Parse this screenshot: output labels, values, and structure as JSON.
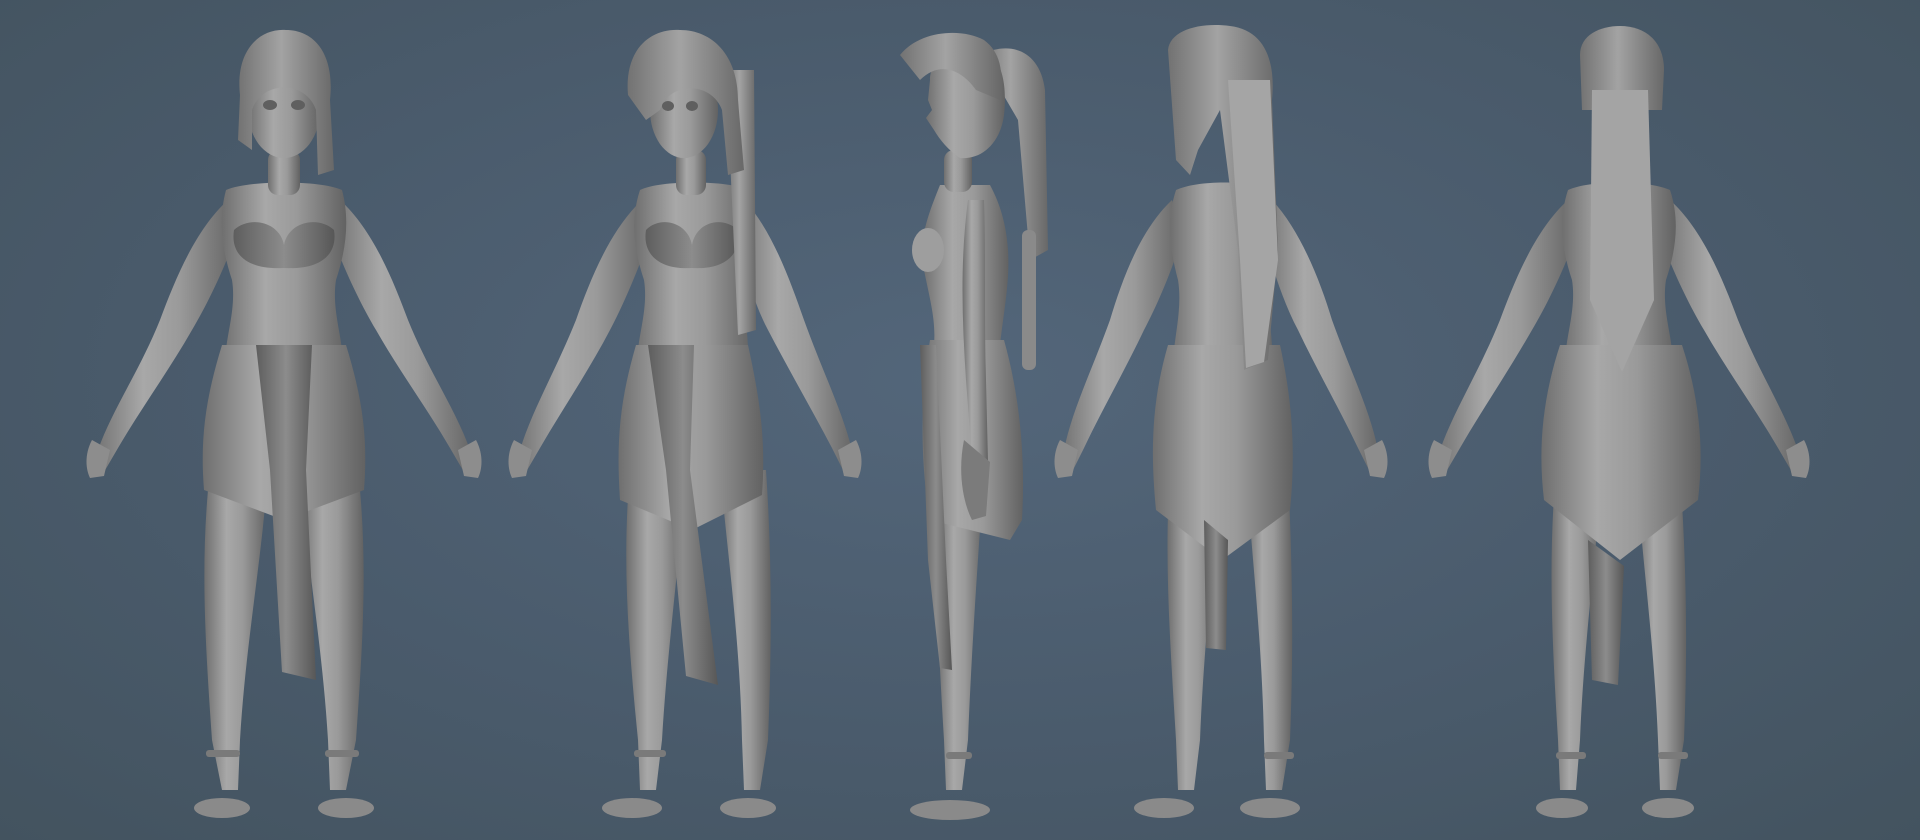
{
  "scene": {
    "background_color": "#4a5b6c",
    "material_color": "#9a9a9a",
    "views": [
      {
        "name": "front-view"
      },
      {
        "name": "three-quarter-front-view"
      },
      {
        "name": "side-profile-view"
      },
      {
        "name": "three-quarter-back-view"
      },
      {
        "name": "back-view"
      }
    ]
  }
}
